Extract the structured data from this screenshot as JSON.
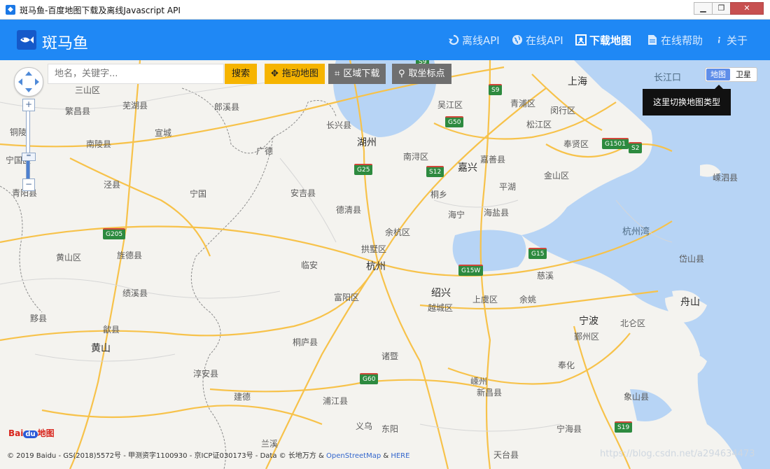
{
  "window": {
    "title": "斑马鱼-百度地图下载及离线Javascript API",
    "app_icon": "fish-icon",
    "minimize_symbol": "▁",
    "maximize_symbol": "❐",
    "close_symbol": "✕"
  },
  "header": {
    "brand": "斑马鱼",
    "logo_icon": "fish-icon",
    "nav": [
      {
        "label": "离线API",
        "icon": "refresh-icon",
        "active": false
      },
      {
        "label": "在线API",
        "icon": "globe-icon",
        "active": false
      },
      {
        "label": "下载地图",
        "icon": "map-download-icon",
        "active": true
      },
      {
        "label": "在线帮助",
        "icon": "document-icon",
        "active": false
      },
      {
        "label": "关于",
        "icon": "info-icon",
        "active": false
      }
    ]
  },
  "toolbar": {
    "search_placeholder": "地名，关键字...",
    "search_label": "搜索",
    "drag_label": "拖动地图",
    "area_label": "区域下载",
    "pick_label": "取坐标点"
  },
  "map_type": {
    "map_label": "地图",
    "satellite_label": "卫星",
    "selected": "地图",
    "tooltip": "这里切换地图类型"
  },
  "zoom": {
    "in_symbol": "+",
    "out_symbol": "−"
  },
  "places": [
    {
      "name": "三山区"
    },
    {
      "name": "芜湖县"
    },
    {
      "name": "郎溪县"
    },
    {
      "name": "繁昌县"
    },
    {
      "name": "铜陵"
    },
    {
      "name": "宣城"
    },
    {
      "name": "南陵县"
    },
    {
      "name": "广德"
    },
    {
      "name": "长兴县"
    },
    {
      "name": "湖州"
    },
    {
      "name": "安吉县"
    },
    {
      "name": "泾县"
    },
    {
      "name": "宁国"
    },
    {
      "name": "德清县"
    },
    {
      "name": "旌德县"
    },
    {
      "name": "黄山区"
    },
    {
      "name": "绩溪县"
    },
    {
      "name": "余杭区"
    },
    {
      "name": "拱墅区"
    },
    {
      "name": "杭州"
    },
    {
      "name": "临安"
    },
    {
      "name": "富阳区"
    },
    {
      "name": "黟县"
    },
    {
      "name": "歙县"
    },
    {
      "name": "黄山"
    },
    {
      "name": "桐庐县"
    },
    {
      "name": "淳安县"
    },
    {
      "name": "建德"
    },
    {
      "name": "浦江县"
    },
    {
      "name": "诸暨"
    },
    {
      "name": "义乌"
    },
    {
      "name": "东阳"
    },
    {
      "name": "兰溪"
    },
    {
      "name": "嵊州"
    },
    {
      "name": "新昌县"
    },
    {
      "name": "天台县"
    },
    {
      "name": "越城区"
    },
    {
      "name": "绍兴"
    },
    {
      "name": "上虞区"
    },
    {
      "name": "余姚"
    },
    {
      "name": "慈溪"
    },
    {
      "name": "宁波"
    },
    {
      "name": "鄞州区"
    },
    {
      "name": "北仑区"
    },
    {
      "name": "奉化"
    },
    {
      "name": "象山县"
    },
    {
      "name": "宁海县"
    },
    {
      "name": "舟山"
    },
    {
      "name": "岱山县"
    },
    {
      "name": "嵊泗县"
    },
    {
      "name": "杭州湾"
    },
    {
      "name": "海宁"
    },
    {
      "name": "海盐县"
    },
    {
      "name": "桐乡"
    },
    {
      "name": "平湖"
    },
    {
      "name": "嘉兴"
    },
    {
      "name": "嘉善县"
    },
    {
      "name": "南浔区"
    },
    {
      "name": "吴江区"
    },
    {
      "name": "青浦区"
    },
    {
      "name": "闵行区"
    },
    {
      "name": "松江区"
    },
    {
      "name": "奉贤区"
    },
    {
      "name": "金山区"
    },
    {
      "name": "上海"
    },
    {
      "name": "长江口"
    },
    {
      "name": "宁国区"
    },
    {
      "name": "青阳县"
    }
  ],
  "highways": [
    "S9",
    "S9",
    "G50",
    "G1501",
    "S2",
    "G25",
    "S12",
    "G205",
    "G15",
    "G15W",
    "G60",
    "S19"
  ],
  "attribution": {
    "copyright": "© 2019 Baidu - GS(2018)5572号 - 甲测资字1100930 - 京ICP证030173号 - Data © 长地万方 & ",
    "osm": "OpenStreetMap",
    "amp": " & ",
    "here": "HERE",
    "baidu_logo_text": "Bai",
    "baidu_logo_paw": "du",
    "baidu_logo_suffix": "地图",
    "watermark": "https://blog.csdn.net/a294634473"
  }
}
